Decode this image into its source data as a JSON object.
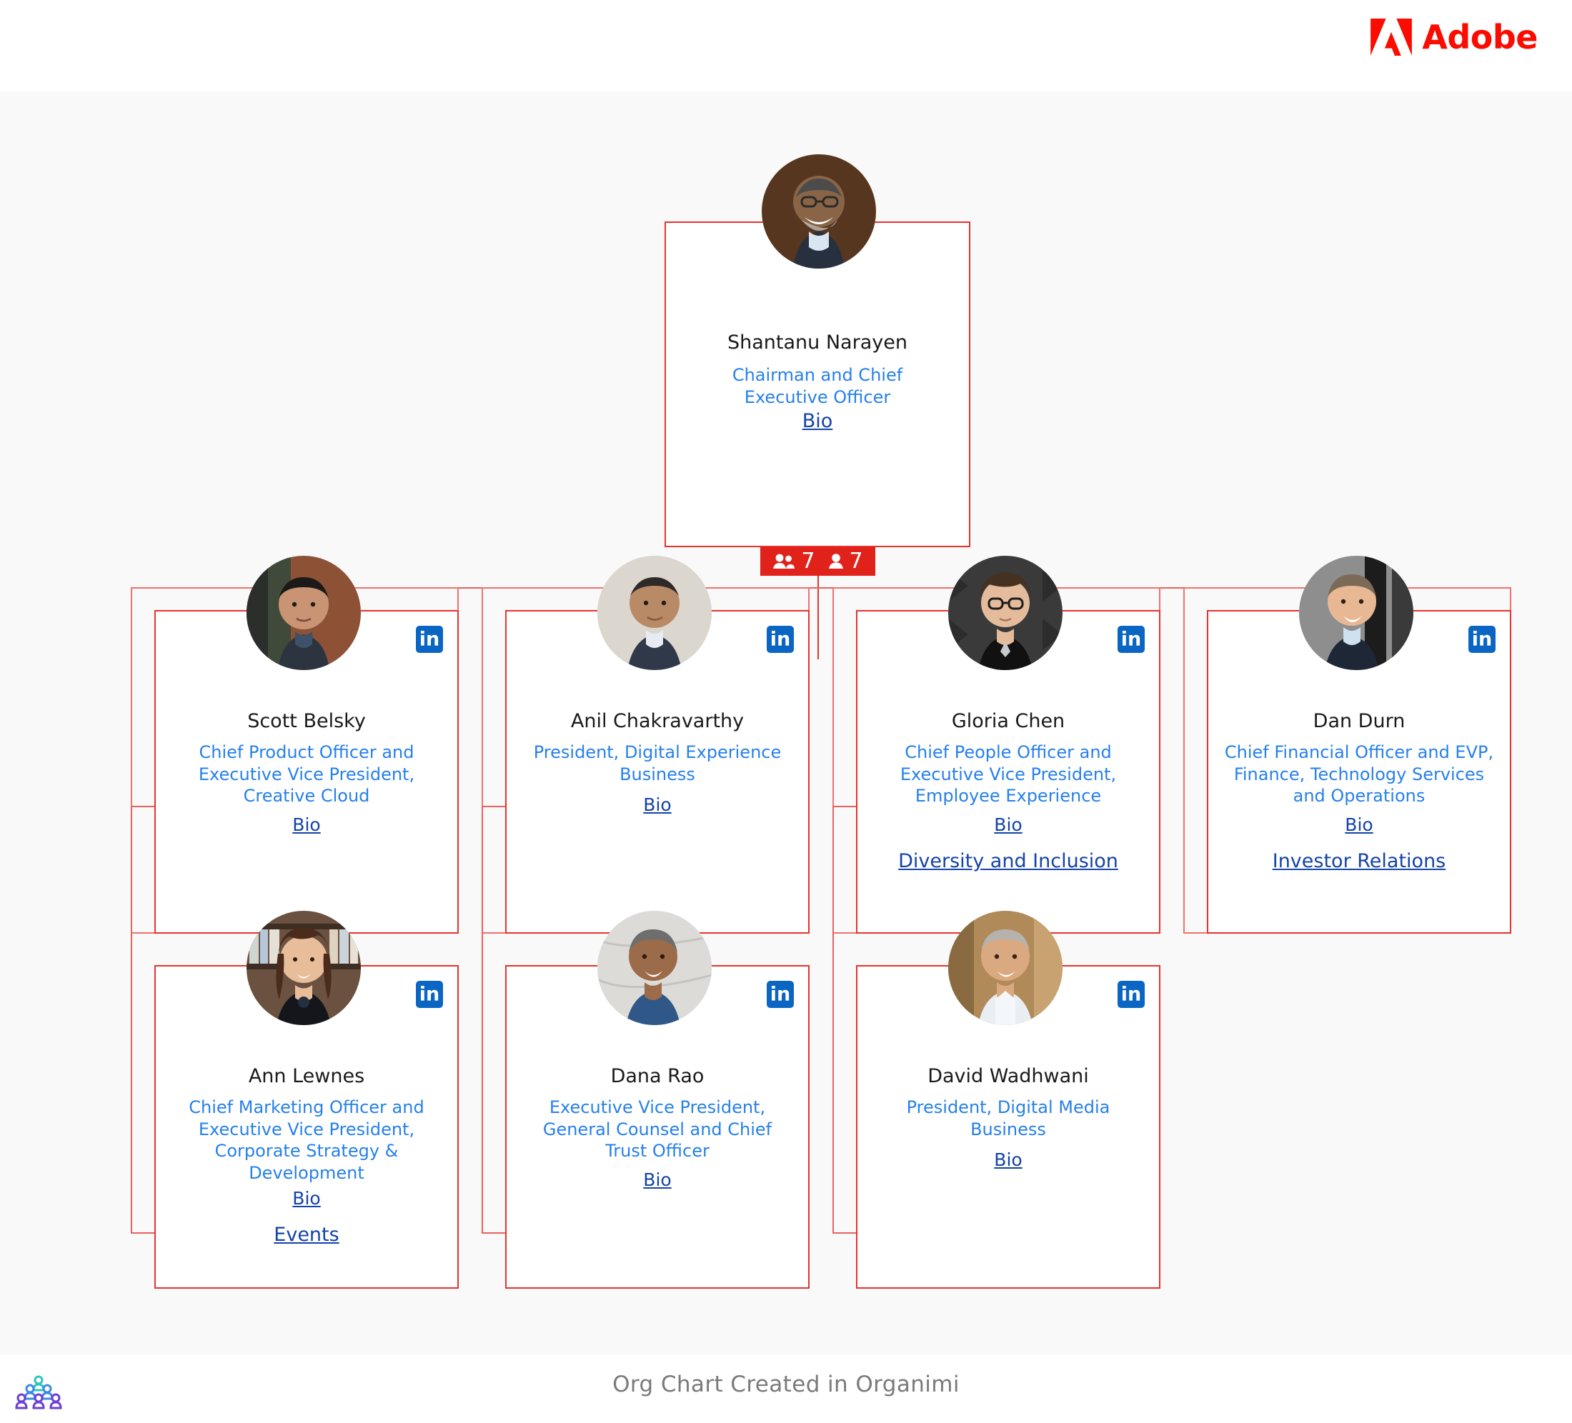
{
  "header": {
    "brand": "Adobe",
    "logo_icon": "adobe-a-mark"
  },
  "footer": {
    "text": "Org Chart Created in Organimi",
    "logo_icon": "organimi-pyramid-logo"
  },
  "badge": {
    "group_icon": "people-group-icon",
    "group_count": "7",
    "person_icon": "single-person-icon",
    "person_count": "7"
  },
  "colors": {
    "brand_red": "#FA0C00",
    "card_border": "#e8322c",
    "group_border": "#f0726e",
    "title_blue": "#2680eb",
    "link_blue": "#1543a8",
    "badge_red": "#e0221b",
    "linkedin_blue": "#0a66c2",
    "canvas_bg": "#f9f9f9"
  },
  "ceo": {
    "name": "Shantanu Narayen",
    "title": "Chairman and Chief Executive Officer",
    "links": [
      "Bio"
    ],
    "avatar_icon": "avatar-shantanu-narayen"
  },
  "reports": [
    {
      "name": "Scott Belsky",
      "title": "Chief Product Officer and Executive Vice President, Creative Cloud",
      "links": [
        "Bio"
      ],
      "avatar_icon": "avatar-scott-belsky",
      "linkedin_icon": "linkedin-icon",
      "linkedin_label": "in"
    },
    {
      "name": "Anil Chakravarthy",
      "title": "President, Digital Experience Business",
      "links": [
        "Bio"
      ],
      "avatar_icon": "avatar-anil-chakravarthy",
      "linkedin_icon": "linkedin-icon",
      "linkedin_label": "in"
    },
    {
      "name": "Gloria Chen",
      "title": "Chief People Officer and Executive Vice President, Employee Experience",
      "links": [
        "Bio",
        "Diversity and Inclusion"
      ],
      "avatar_icon": "avatar-gloria-chen",
      "linkedin_icon": "linkedin-icon",
      "linkedin_label": "in"
    },
    {
      "name": "Dan Durn",
      "title": "Chief Financial Officer and EVP, Finance, Technology Services and Operations",
      "links": [
        "Bio",
        "Investor Relations"
      ],
      "avatar_icon": "avatar-dan-durn",
      "linkedin_icon": "linkedin-icon",
      "linkedin_label": "in"
    },
    {
      "name": "Ann Lewnes",
      "title": "Chief Marketing Officer and Executive Vice President, Corporate Strategy & Development",
      "links": [
        "Bio",
        "Events"
      ],
      "avatar_icon": "avatar-ann-lewnes",
      "linkedin_icon": "linkedin-icon",
      "linkedin_label": "in"
    },
    {
      "name": "Dana Rao",
      "title": "Executive Vice President, General Counsel and Chief Trust Officer",
      "links": [
        "Bio"
      ],
      "avatar_icon": "avatar-dana-rao",
      "linkedin_icon": "linkedin-icon",
      "linkedin_label": "in"
    },
    {
      "name": "David Wadhwani",
      "title": "President, Digital Media Business",
      "links": [
        "Bio"
      ],
      "avatar_icon": "avatar-david-wadhwani",
      "linkedin_icon": "linkedin-icon",
      "linkedin_label": "in"
    }
  ]
}
